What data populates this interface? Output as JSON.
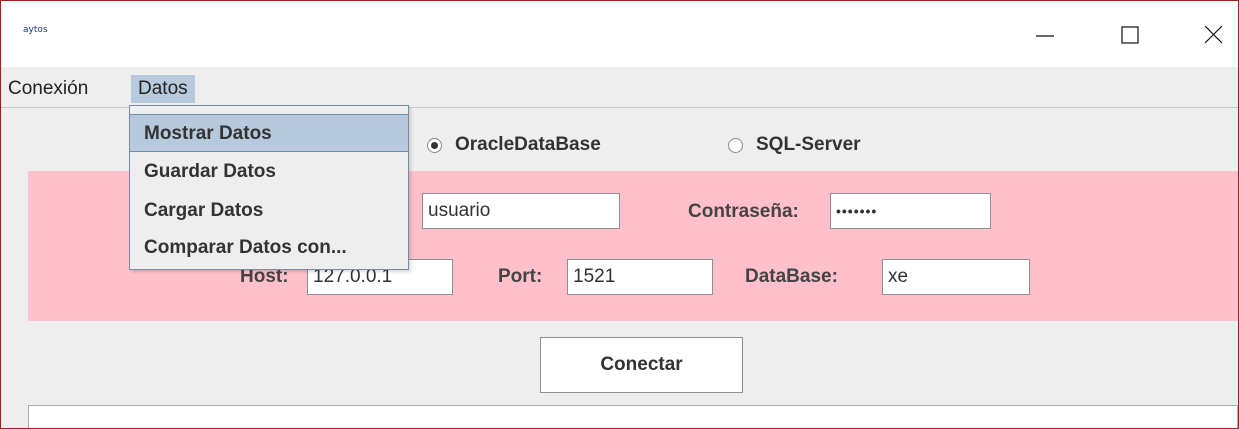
{
  "window": {
    "title": "aytos",
    "controls": {
      "minimize": "minimize-icon",
      "maximize": "maximize-icon",
      "close": "close-icon"
    }
  },
  "menubar": {
    "items": [
      "Conexión",
      "Datos"
    ],
    "active": "Datos"
  },
  "dropdown": {
    "items": [
      "Mostrar Datos",
      "Guardar Datos",
      "Cargar Datos",
      "Comparar Datos con..."
    ],
    "highlighted": "Mostrar Datos"
  },
  "db_type": {
    "options": [
      "OracleDataBase",
      "SQL-Server"
    ],
    "selected": "OracleDataBase"
  },
  "form": {
    "user_value": "usuario",
    "password_label": "Contraseña:",
    "password_value": "•••••••",
    "host_label": "Host:",
    "host_value": "127.0.0.1",
    "port_label": "Port:",
    "port_value": "1521",
    "database_label": "DataBase:",
    "database_value": "xe"
  },
  "actions": {
    "connect_label": "Conectar"
  },
  "colors": {
    "form_background": "#ffc0cb",
    "menu_highlight": "#b7c9dc",
    "window_border": "#9e2222"
  }
}
